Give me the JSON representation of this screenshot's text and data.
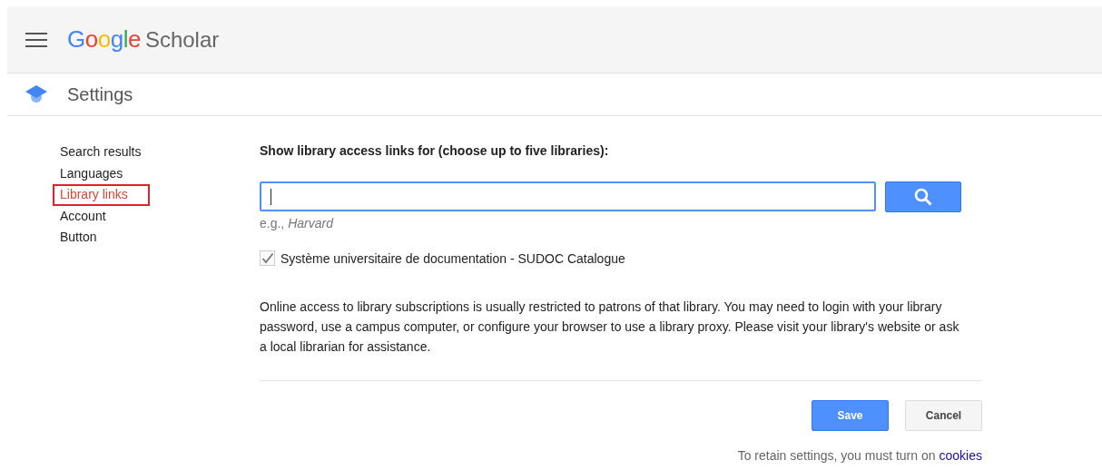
{
  "header": {
    "logo": {
      "brand": "Google",
      "product": "Scholar"
    }
  },
  "page_title": "Settings",
  "sidebar": {
    "items": [
      {
        "label": "Search results",
        "selected": false
      },
      {
        "label": "Languages",
        "selected": false
      },
      {
        "label": "Library links",
        "selected": true
      },
      {
        "label": "Account",
        "selected": false
      },
      {
        "label": "Button",
        "selected": false
      }
    ]
  },
  "library": {
    "heading": "Show library access links for (choose up to five libraries):",
    "search": {
      "hint_prefix": "e.g., ",
      "hint_example": "Harvard"
    },
    "libraries": [
      {
        "label": "Système universitaire de documentation - SUDOC Catalogue",
        "checked": true
      }
    ],
    "note": "Online access to library subscriptions is usually restricted to patrons of that library. You may need to login with your library password, use a campus computer, or configure your browser to use a library proxy. Please visit your library's website or ask a local librarian for assistance."
  },
  "buttons": {
    "save": "Save",
    "cancel": "Cancel"
  },
  "footer": {
    "text": "To retain settings, you must turn on",
    "link": "cookies"
  }
}
